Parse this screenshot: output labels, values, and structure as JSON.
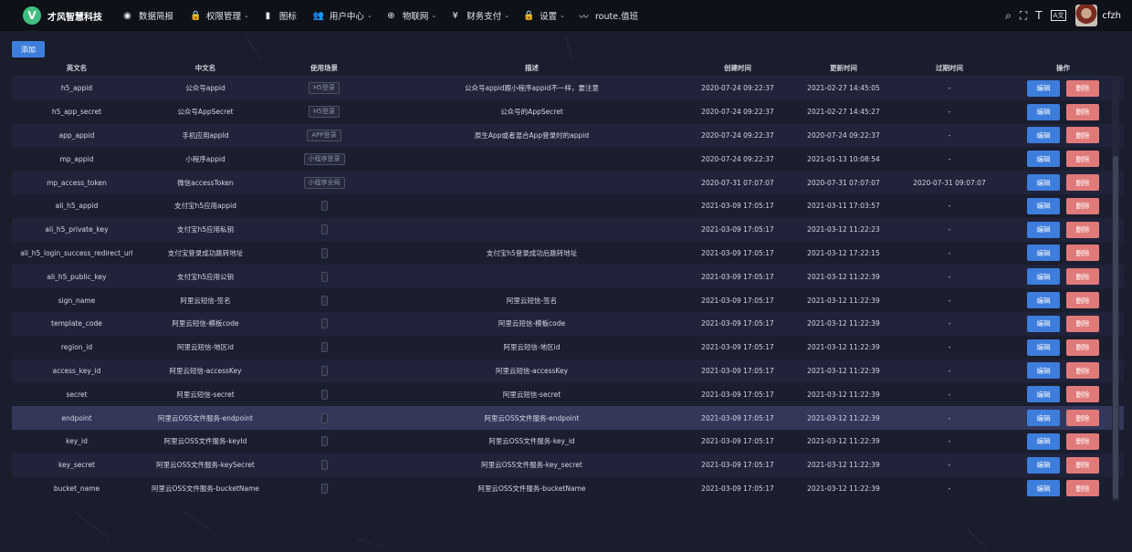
{
  "brand": {
    "logo_letter": "V",
    "name": "才风智慧科技"
  },
  "nav": [
    {
      "icon": "◉",
      "label": "数据简报",
      "chevron": ""
    },
    {
      "icon": "🔒",
      "label": "权限管理",
      "chevron": "⌄"
    },
    {
      "icon": "▮",
      "label": "图标",
      "chevron": ""
    },
    {
      "icon": "👥",
      "label": "用户中心",
      "chevron": "⌄"
    },
    {
      "icon": "⊕",
      "label": "物联网",
      "chevron": "⌄"
    },
    {
      "icon": "¥",
      "label": "财务支付",
      "chevron": "⌄"
    },
    {
      "icon": "🔒",
      "label": "设置",
      "chevron": "⌄"
    },
    {
      "icon": "〰",
      "label": "route.值班",
      "chevron": ""
    }
  ],
  "tools": {
    "search": "⌕",
    "fullscreen": "⛶",
    "font_size": "T",
    "lang": "A文",
    "user_name": "cfzh"
  },
  "add_label": "添加",
  "columns": [
    "英文名",
    "中文名",
    "使用场景",
    "描述",
    "创建时间",
    "更新时间",
    "过期时间",
    "操作"
  ],
  "edit_label": "编辑",
  "delete_label": "删除",
  "rows": [
    {
      "en": "h5_appid",
      "cn": "公众号appid",
      "scene": "H5登录",
      "desc": "公众号appid跟小程序appid不一样，要注意",
      "created": "2020-07-24 09:22:37",
      "updated": "2021-02-27 14:45:05",
      "expire": "-"
    },
    {
      "en": "h5_app_secret",
      "cn": "公众号AppSecret",
      "scene": "H5登录",
      "desc": "公众号的AppSecret",
      "created": "2020-07-24 09:22:37",
      "updated": "2021-02-27 14:45:27",
      "expire": "-"
    },
    {
      "en": "app_appid",
      "cn": "手机应用appId",
      "scene": "APP登录",
      "desc": "原生App或者混合App登录时的appid",
      "created": "2020-07-24 09:22:37",
      "updated": "2020-07-24 09:22:37",
      "expire": "-"
    },
    {
      "en": "mp_appid",
      "cn": "小程序appid",
      "scene": "小程序登录",
      "desc": "",
      "created": "2020-07-24 09:22:37",
      "updated": "2021-01-13 10:08:54",
      "expire": "-"
    },
    {
      "en": "mp_access_token",
      "cn": "微信accessToken",
      "scene": "小程序全局",
      "desc": "",
      "created": "2020-07-31 07:07:07",
      "updated": "2020-07-31 07:07:07",
      "expire": "2020-07-31 09:07:07"
    },
    {
      "en": "ali_h5_appid",
      "cn": "支付宝h5应用appid",
      "scene": "",
      "desc": "",
      "created": "2021-03-09 17:05:17",
      "updated": "2021-03-11 17:03:57",
      "expire": "-"
    },
    {
      "en": "ali_h5_private_key",
      "cn": "支付宝h5应用私钥",
      "scene": "",
      "desc": "",
      "created": "2021-03-09 17:05:17",
      "updated": "2021-03-12 11:22:23",
      "expire": "-"
    },
    {
      "en": "ali_h5_login_success_redirect_url",
      "cn": "支付宝登录成功跳转地址",
      "scene": "",
      "desc": "支付宝h5登录成功后跳转地址",
      "created": "2021-03-09 17:05:17",
      "updated": "2021-03-12 17:22:15",
      "expire": "-"
    },
    {
      "en": "ali_h5_public_key",
      "cn": "支付宝h5应用公钥",
      "scene": "",
      "desc": "",
      "created": "2021-03-09 17:05:17",
      "updated": "2021-03-12 11:22:39",
      "expire": "-"
    },
    {
      "en": "sign_name",
      "cn": "阿里云短信-签名",
      "scene": "",
      "desc": "阿里云短信-签名",
      "created": "2021-03-09 17:05:17",
      "updated": "2021-03-12 11:22:39",
      "expire": "-"
    },
    {
      "en": "template_code",
      "cn": "阿里云短信-模板code",
      "scene": "",
      "desc": "阿里云短信-模板code",
      "created": "2021-03-09 17:05:17",
      "updated": "2021-03-12 11:22:39",
      "expire": "-"
    },
    {
      "en": "region_id",
      "cn": "阿里云短信-地区id",
      "scene": "",
      "desc": "阿里云短信-地区id",
      "created": "2021-03-09 17:05:17",
      "updated": "2021-03-12 11:22:39",
      "expire": "-"
    },
    {
      "en": "access_key_id",
      "cn": "阿里云短信-accessKey",
      "scene": "",
      "desc": "阿里云短信-accessKey",
      "created": "2021-03-09 17:05:17",
      "updated": "2021-03-12 11:22:39",
      "expire": "-"
    },
    {
      "en": "secret",
      "cn": "阿里云短信-secret",
      "scene": "",
      "desc": "阿里云短信-secret",
      "created": "2021-03-09 17:05:17",
      "updated": "2021-03-12 11:22:39",
      "expire": "-"
    },
    {
      "en": "endpoint",
      "cn": "阿里云OSS文件服务-endpoint",
      "scene": "",
      "desc": "阿里云OSS文件服务-endpoint",
      "created": "2021-03-09 17:05:17",
      "updated": "2021-03-12 11:22:39",
      "expire": "-"
    },
    {
      "en": "key_id",
      "cn": "阿里云OSS文件服务-keyId",
      "scene": "",
      "desc": "阿里云OSS文件服务-key_id",
      "created": "2021-03-09 17:05:17",
      "updated": "2021-03-12 11:22:39",
      "expire": "-"
    },
    {
      "en": "key_secret",
      "cn": "阿里云OSS文件服务-keySecret",
      "scene": "",
      "desc": "阿里云OSS文件服务-key_secret",
      "created": "2021-03-09 17:05:17",
      "updated": "2021-03-12 11:22:39",
      "expire": "-"
    },
    {
      "en": "bucket_name",
      "cn": "阿里云OSS文件服务-bucketName",
      "scene": "",
      "desc": "阿里云OSS文件服务-bucketName",
      "created": "2021-03-09 17:05:17",
      "updated": "2021-03-12 11:22:39",
      "expire": "-"
    }
  ],
  "highlighted_row": 14,
  "colors": {
    "accent": "#3d7ddb",
    "danger": "#e07a7a",
    "bg": "#1a1d2b",
    "topbar": "#0f1119"
  }
}
